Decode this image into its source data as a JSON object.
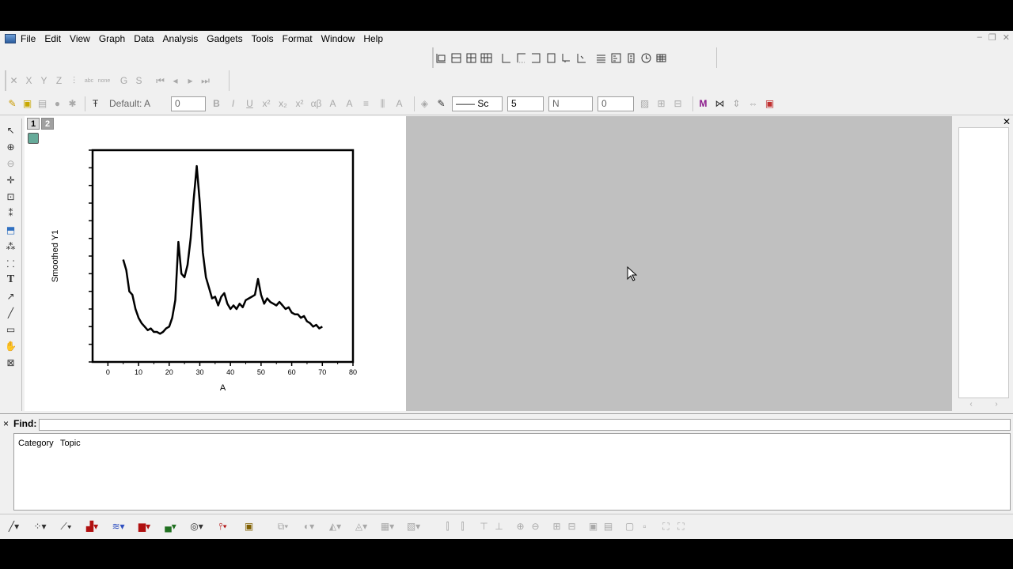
{
  "menu": {
    "items": [
      "File",
      "Edit",
      "View",
      "Graph",
      "Data",
      "Analysis",
      "Gadgets",
      "Tools",
      "Format",
      "Window",
      "Help"
    ]
  },
  "window_controls": {
    "minimize": "–",
    "restore": "❐",
    "close": "✕"
  },
  "toolbar_xyz": [
    "X",
    "Y",
    "Z",
    "G",
    "S"
  ],
  "format_toolbar": {
    "font_name": "Default: A",
    "font_size": "0",
    "line_style": "—— Sc",
    "line_width": "5",
    "fill_label": "N",
    "fill_value": "0"
  },
  "graph": {
    "layer_tabs": [
      "1",
      "2"
    ]
  },
  "chart_data": {
    "type": "line",
    "xlabel": "A",
    "ylabel": "Smoothed Y1",
    "xlim": [
      -5,
      80
    ],
    "ylim": [
      0,
      1.2
    ],
    "xticks": [
      "0",
      "10",
      "20",
      "30",
      "40",
      "50",
      "60",
      "70",
      "80"
    ],
    "series": [
      {
        "x": [
          5,
          6,
          7,
          8,
          9,
          10,
          11,
          12,
          13,
          14,
          15,
          16,
          17,
          18,
          19,
          20,
          21,
          22,
          23,
          24,
          25,
          26,
          27,
          28,
          29,
          30,
          31,
          32,
          33,
          34,
          35,
          36,
          37,
          38,
          39,
          40,
          41,
          42,
          43,
          44,
          45,
          46,
          47,
          48,
          49,
          50,
          51,
          52,
          53,
          54,
          55,
          56,
          57,
          58,
          59,
          60,
          61,
          62,
          63,
          64,
          65,
          66,
          67,
          68,
          69,
          70
        ],
        "y": [
          0.58,
          0.52,
          0.4,
          0.38,
          0.3,
          0.25,
          0.22,
          0.2,
          0.18,
          0.19,
          0.17,
          0.17,
          0.16,
          0.17,
          0.19,
          0.2,
          0.25,
          0.35,
          0.68,
          0.5,
          0.48,
          0.55,
          0.7,
          0.92,
          1.11,
          0.9,
          0.62,
          0.48,
          0.42,
          0.36,
          0.37,
          0.32,
          0.37,
          0.39,
          0.33,
          0.3,
          0.32,
          0.3,
          0.33,
          0.31,
          0.35,
          0.36,
          0.37,
          0.38,
          0.47,
          0.38,
          0.33,
          0.36,
          0.34,
          0.33,
          0.32,
          0.34,
          0.32,
          0.3,
          0.31,
          0.28,
          0.27,
          0.27,
          0.25,
          0.26,
          0.23,
          0.22,
          0.2,
          0.21,
          0.19,
          0.2
        ]
      }
    ]
  },
  "find": {
    "label": "Find:",
    "close": "×",
    "tabs": [
      "Category",
      "Topic"
    ]
  }
}
